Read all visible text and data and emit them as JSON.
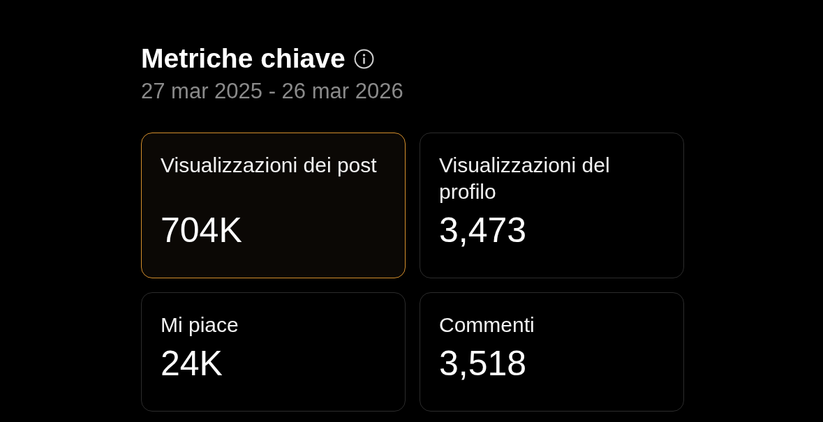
{
  "header": {
    "title": "Metriche chiave",
    "date_range": "27 mar 2025 - 26 mar 2026"
  },
  "metrics": [
    {
      "label": "Visualizzazioni dei post",
      "value": "704K",
      "selected": true
    },
    {
      "label": "Visualizzazioni del profilo",
      "value": "3,473",
      "selected": false
    },
    {
      "label": "Mi piace",
      "value": "24K",
      "selected": false
    },
    {
      "label": "Commenti",
      "value": "3,518",
      "selected": false
    }
  ]
}
